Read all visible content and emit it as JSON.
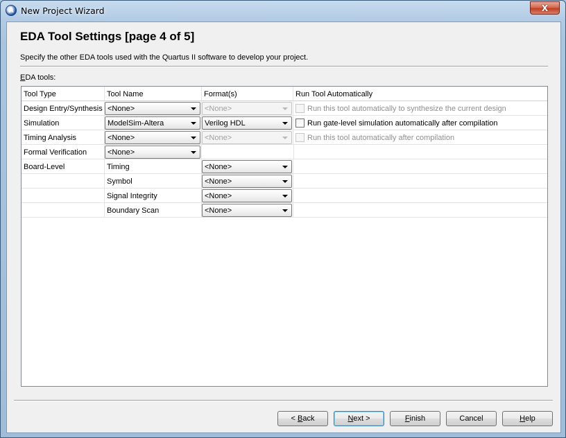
{
  "window": {
    "title": "New Project Wizard",
    "close_glyph": "X"
  },
  "page": {
    "title": "EDA Tool Settings [page 4 of 5]",
    "description": "Specify the other EDA tools used with the Quartus II software to develop your project.",
    "tools_label_mnemonic": "E",
    "tools_label_rest": "DA tools:"
  },
  "table": {
    "headers": [
      "Tool Type",
      "Tool Name",
      "Format(s)",
      "Run Tool Automatically"
    ],
    "rows": [
      {
        "tool_type": "Design Entry/Synthesis",
        "tool_name": "<None>",
        "format": "<None>",
        "format_enabled": false,
        "run_text": "Run this tool automatically to synthesize the current design",
        "run_enabled": false,
        "checked": false
      },
      {
        "tool_type": "Simulation",
        "tool_name": "ModelSim-Altera",
        "format": "Verilog HDL",
        "format_enabled": true,
        "run_text": "Run gate-level simulation automatically after compilation",
        "run_enabled": true,
        "checked": false
      },
      {
        "tool_type": "Timing Analysis",
        "tool_name": "<None>",
        "format": "<None>",
        "format_enabled": false,
        "run_text": "Run this tool automatically after compilation",
        "run_enabled": false,
        "checked": false
      },
      {
        "tool_type": "Formal Verification",
        "tool_name": "<None>"
      }
    ],
    "board_level": {
      "tool_type": "Board-Level",
      "items": [
        {
          "name": "Timing",
          "format": "<None>"
        },
        {
          "name": "Symbol",
          "format": "<None>"
        },
        {
          "name": "Signal Integrity",
          "format": "<None>"
        },
        {
          "name": "Boundary Scan",
          "format": "<None>"
        }
      ]
    }
  },
  "buttons": {
    "back": {
      "prefix": "< ",
      "mnemonic": "B",
      "rest": "ack"
    },
    "next": {
      "mnemonic": "N",
      "rest": "ext >"
    },
    "finish": {
      "mnemonic": "F",
      "rest": "inish"
    },
    "cancel": {
      "label": "Cancel"
    },
    "help": {
      "mnemonic": "H",
      "rest": "elp"
    }
  }
}
